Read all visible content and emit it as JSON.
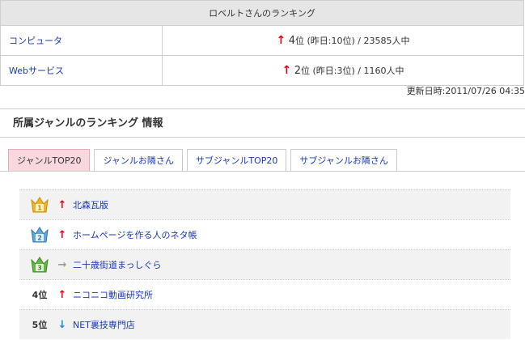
{
  "ranking": {
    "title": "ロベルトさんのランキング",
    "rows": [
      {
        "category": "コンピュータ",
        "rank": "4",
        "suffix": "位",
        "prev": "(昨日:10位)",
        "total": " / 23585人中"
      },
      {
        "category": "Webサービス",
        "rank": "2",
        "suffix": "位",
        "prev": "(昨日:3位)",
        "total": " / 1160人中"
      }
    ],
    "updated_label": "更新日時:",
    "updated_value": "2011/07/26 04:35"
  },
  "section": {
    "title": "所属ジャンルのランキング 情報"
  },
  "tabs": [
    {
      "label": "ジャンルTOP20"
    },
    {
      "label": "ジャンルお隣さん"
    },
    {
      "label": "サブジャンルTOP20"
    },
    {
      "label": "サブジャンルお隣さん"
    }
  ],
  "list": [
    {
      "pos": "1",
      "trend": "up",
      "name": "北森瓦版"
    },
    {
      "pos": "2",
      "trend": "up",
      "name": "ホームページを作る人のネタ帳"
    },
    {
      "pos": "3",
      "trend": "flat",
      "name": "二十歳街道まっしぐら"
    },
    {
      "pos": "4位",
      "trend": "up",
      "name": "ニコニコ動画研究所"
    },
    {
      "pos": "5位",
      "trend": "down",
      "name": "NET裏技専門店"
    }
  ],
  "colors": {
    "link": "#1a39b8",
    "up": "#e60012",
    "down": "#1a8fd0",
    "flat": "#999999",
    "active_tab": "#f9d7df",
    "gold": "#f5b324",
    "silver": "#5ea8dc",
    "bronze": "#62b844"
  }
}
